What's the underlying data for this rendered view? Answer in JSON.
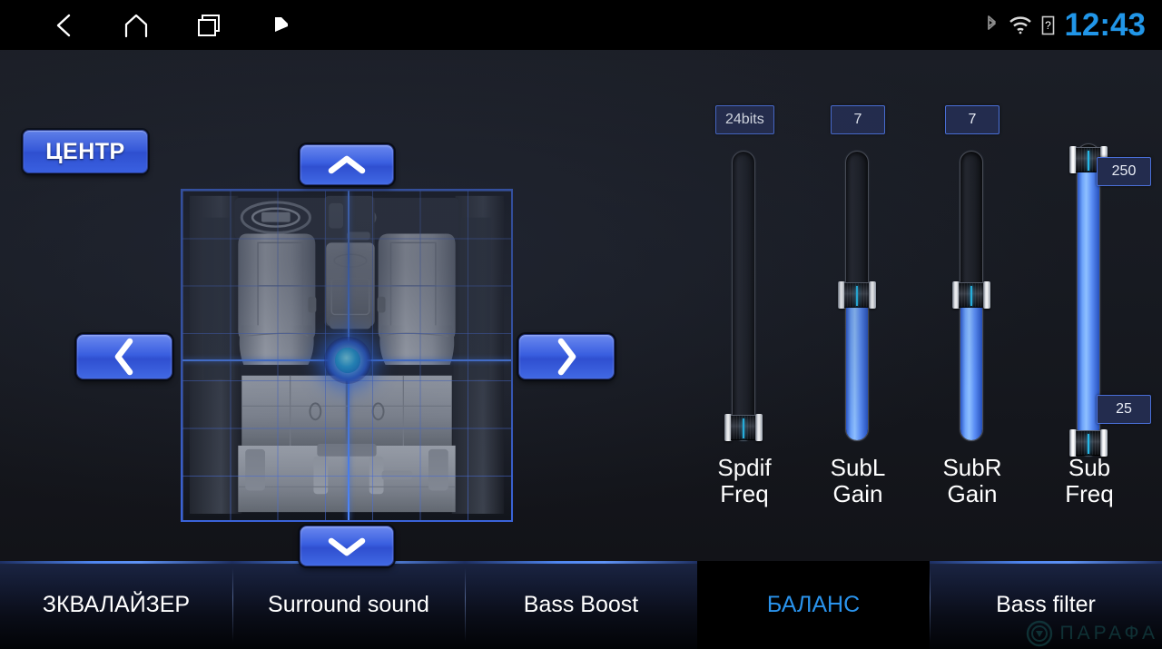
{
  "statusbar": {
    "nav": [
      {
        "name": "back-icon",
        "label": "Back"
      },
      {
        "name": "home-icon",
        "label": "Home"
      },
      {
        "name": "recents-icon",
        "label": "Recent apps"
      },
      {
        "name": "flag-icon",
        "label": "Flag"
      }
    ],
    "indicators": [
      {
        "name": "bluetooth-icon",
        "label": "Bluetooth"
      },
      {
        "name": "wifi-icon",
        "label": "Wi-Fi"
      },
      {
        "name": "sim-icon",
        "label": "SIM"
      }
    ],
    "clock": "12:43"
  },
  "balance": {
    "center_button_label": "ЦЕНТР",
    "arrow_up_label": "Up",
    "arrow_down_label": "Down",
    "arrow_left_label": "Left",
    "arrow_right_label": "Right"
  },
  "sliders": [
    {
      "id": "spdif-freq",
      "label_line1": "Spdif",
      "label_line2": "Freq",
      "value": "24bits",
      "fill_percent": 0,
      "thumb_percent": 3,
      "dual": false
    },
    {
      "id": "subl-gain",
      "label_line1": "SubL",
      "label_line2": "Gain",
      "value": "7",
      "fill_percent": 49,
      "thumb_percent": 49,
      "dual": false
    },
    {
      "id": "subr-gain",
      "label_line1": "SubR",
      "label_line2": "Gain",
      "value": "7",
      "fill_percent": 49,
      "thumb_percent": 49,
      "dual": false
    },
    {
      "id": "sub-freq",
      "label_line1": "Sub",
      "label_line2": "Freq",
      "dual": true,
      "value_high": "250",
      "value_low": "25",
      "thumb_high_percent": 95,
      "thumb_low_percent": 5
    }
  ],
  "tabs": [
    {
      "label": "ЗКВАЛАЙЗЕР",
      "active": false
    },
    {
      "label": "Surround sound",
      "active": false
    },
    {
      "label": "Bass Boost",
      "active": false
    },
    {
      "label": "БАЛАНС",
      "active": true
    },
    {
      "label": "Bass filter",
      "active": false
    }
  ],
  "watermark": {
    "text": "ПАРАФА"
  },
  "colors": {
    "accent_blue": "#2a93ec",
    "button_blue": "#3a5fe0",
    "clock_blue": "#2196e8",
    "valuebox_border": "#4a6fd8",
    "background": "#171a21",
    "watermark_teal": "#1d6b6b"
  }
}
